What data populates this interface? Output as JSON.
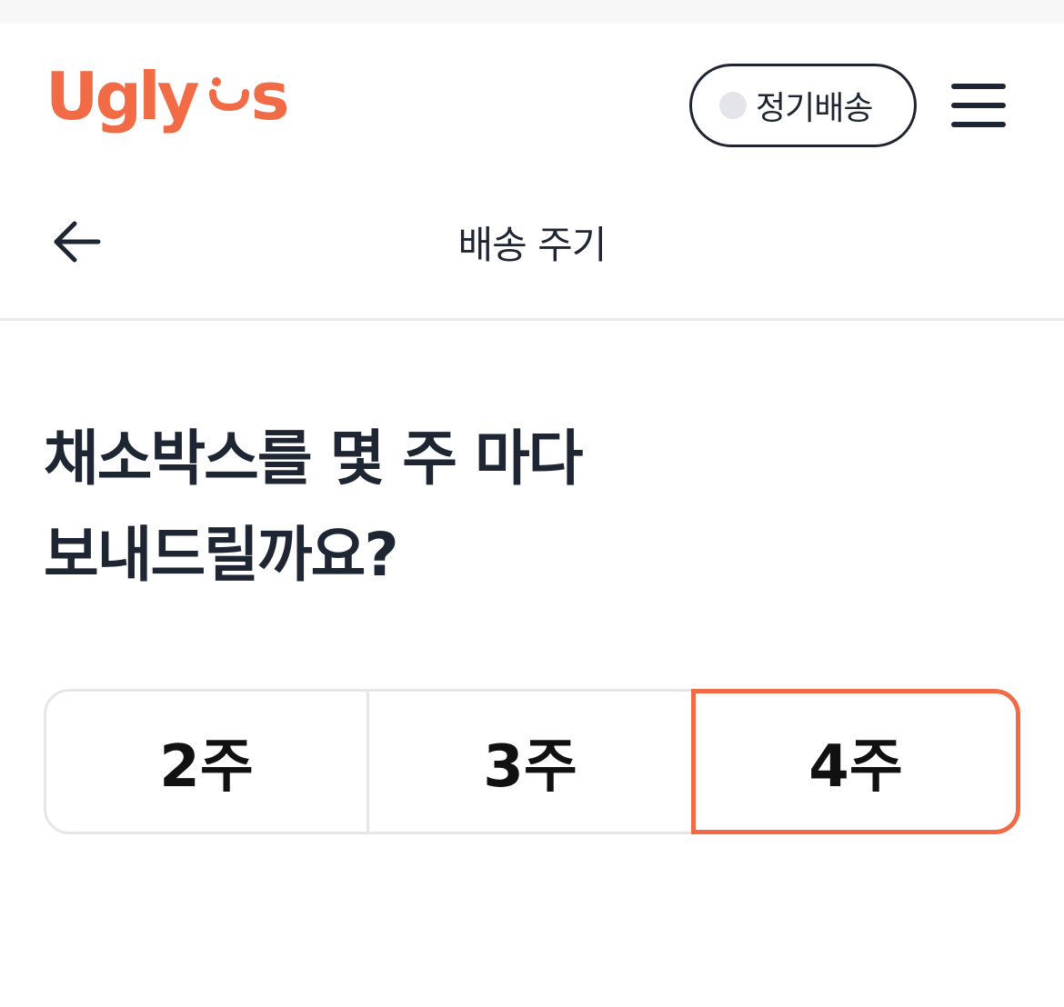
{
  "header": {
    "logo_text": "Ugly Us",
    "subscription_toggle_label": "정기배송",
    "accent_color": "#f26b47"
  },
  "nav": {
    "title": "배송 주기"
  },
  "question": {
    "line1": "채소박스를 몇 주 마다",
    "line2": "보내드릴까요?"
  },
  "options": [
    {
      "label": "2주",
      "selected": false
    },
    {
      "label": "3주",
      "selected": false
    },
    {
      "label": "4주",
      "selected": true
    }
  ]
}
